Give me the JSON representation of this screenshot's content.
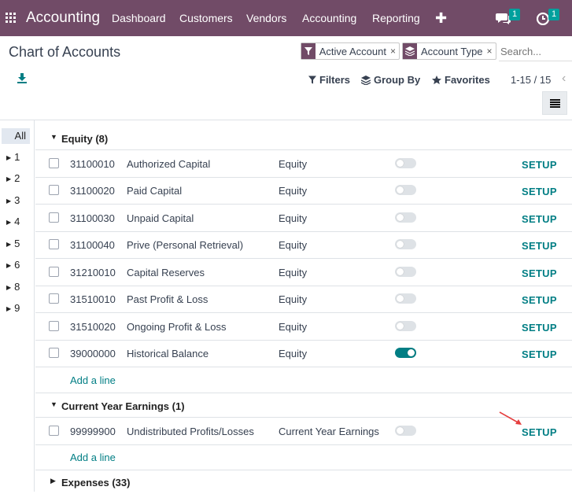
{
  "navbar": {
    "brand": "Accounting",
    "menu": [
      "Dashboard",
      "Customers",
      "Vendors",
      "Accounting",
      "Reporting"
    ],
    "messages_count": "1",
    "activities_count": "1",
    "icons": [
      "apps-icon",
      "plus-icon",
      "chat-icon",
      "clock-icon"
    ]
  },
  "control": {
    "title": "Chart of Accounts",
    "facets": [
      {
        "label": "Active Account",
        "icon": "filter-icon"
      },
      {
        "label": "Account Type",
        "icon": "layers-icon"
      }
    ],
    "search_placeholder": "Search...",
    "filters_label": "Filters",
    "groupby_label": "Group By",
    "favorites_label": "Favorites",
    "pager": "1-15 / 15"
  },
  "sidebar": {
    "all_label": "All",
    "items": [
      "1",
      "2",
      "3",
      "4",
      "5",
      "6",
      "8",
      "9"
    ]
  },
  "groups": [
    {
      "label": "Equity (8)",
      "expanded": true,
      "rows": [
        {
          "code": "31100010",
          "name": "Authorized Capital",
          "type": "Equity",
          "reconcile": false,
          "action": "SETUP"
        },
        {
          "code": "31100020",
          "name": "Paid Capital",
          "type": "Equity",
          "reconcile": false,
          "action": "SETUP"
        },
        {
          "code": "31100030",
          "name": "Unpaid Capital",
          "type": "Equity",
          "reconcile": false,
          "action": "SETUP"
        },
        {
          "code": "31100040",
          "name": "Prive (Personal Retrieval)",
          "type": "Equity",
          "reconcile": false,
          "action": "SETUP"
        },
        {
          "code": "31210010",
          "name": "Capital Reserves",
          "type": "Equity",
          "reconcile": false,
          "action": "SETUP"
        },
        {
          "code": "31510010",
          "name": "Past Profit & Loss",
          "type": "Equity",
          "reconcile": false,
          "action": "SETUP"
        },
        {
          "code": "31510020",
          "name": "Ongoing Profit & Loss",
          "type": "Equity",
          "reconcile": false,
          "action": "SETUP"
        },
        {
          "code": "39000000",
          "name": "Historical Balance",
          "type": "Equity",
          "reconcile": true,
          "action": "SETUP"
        }
      ],
      "add_line": "Add a line"
    },
    {
      "label": "Current Year Earnings (1)",
      "expanded": true,
      "rows": [
        {
          "code": "99999900",
          "name": "Undistributed Profits/Losses",
          "type": "Current Year Earnings",
          "reconcile": false,
          "action": "SETUP"
        }
      ],
      "add_line": "Add a line"
    },
    {
      "label": "Expenses (33)",
      "expanded": false,
      "rows": []
    }
  ],
  "colors": {
    "brand": "#714b67",
    "accent": "#017e84",
    "badge": "#00a09d",
    "annotation_arrow": "#e53e3e"
  }
}
